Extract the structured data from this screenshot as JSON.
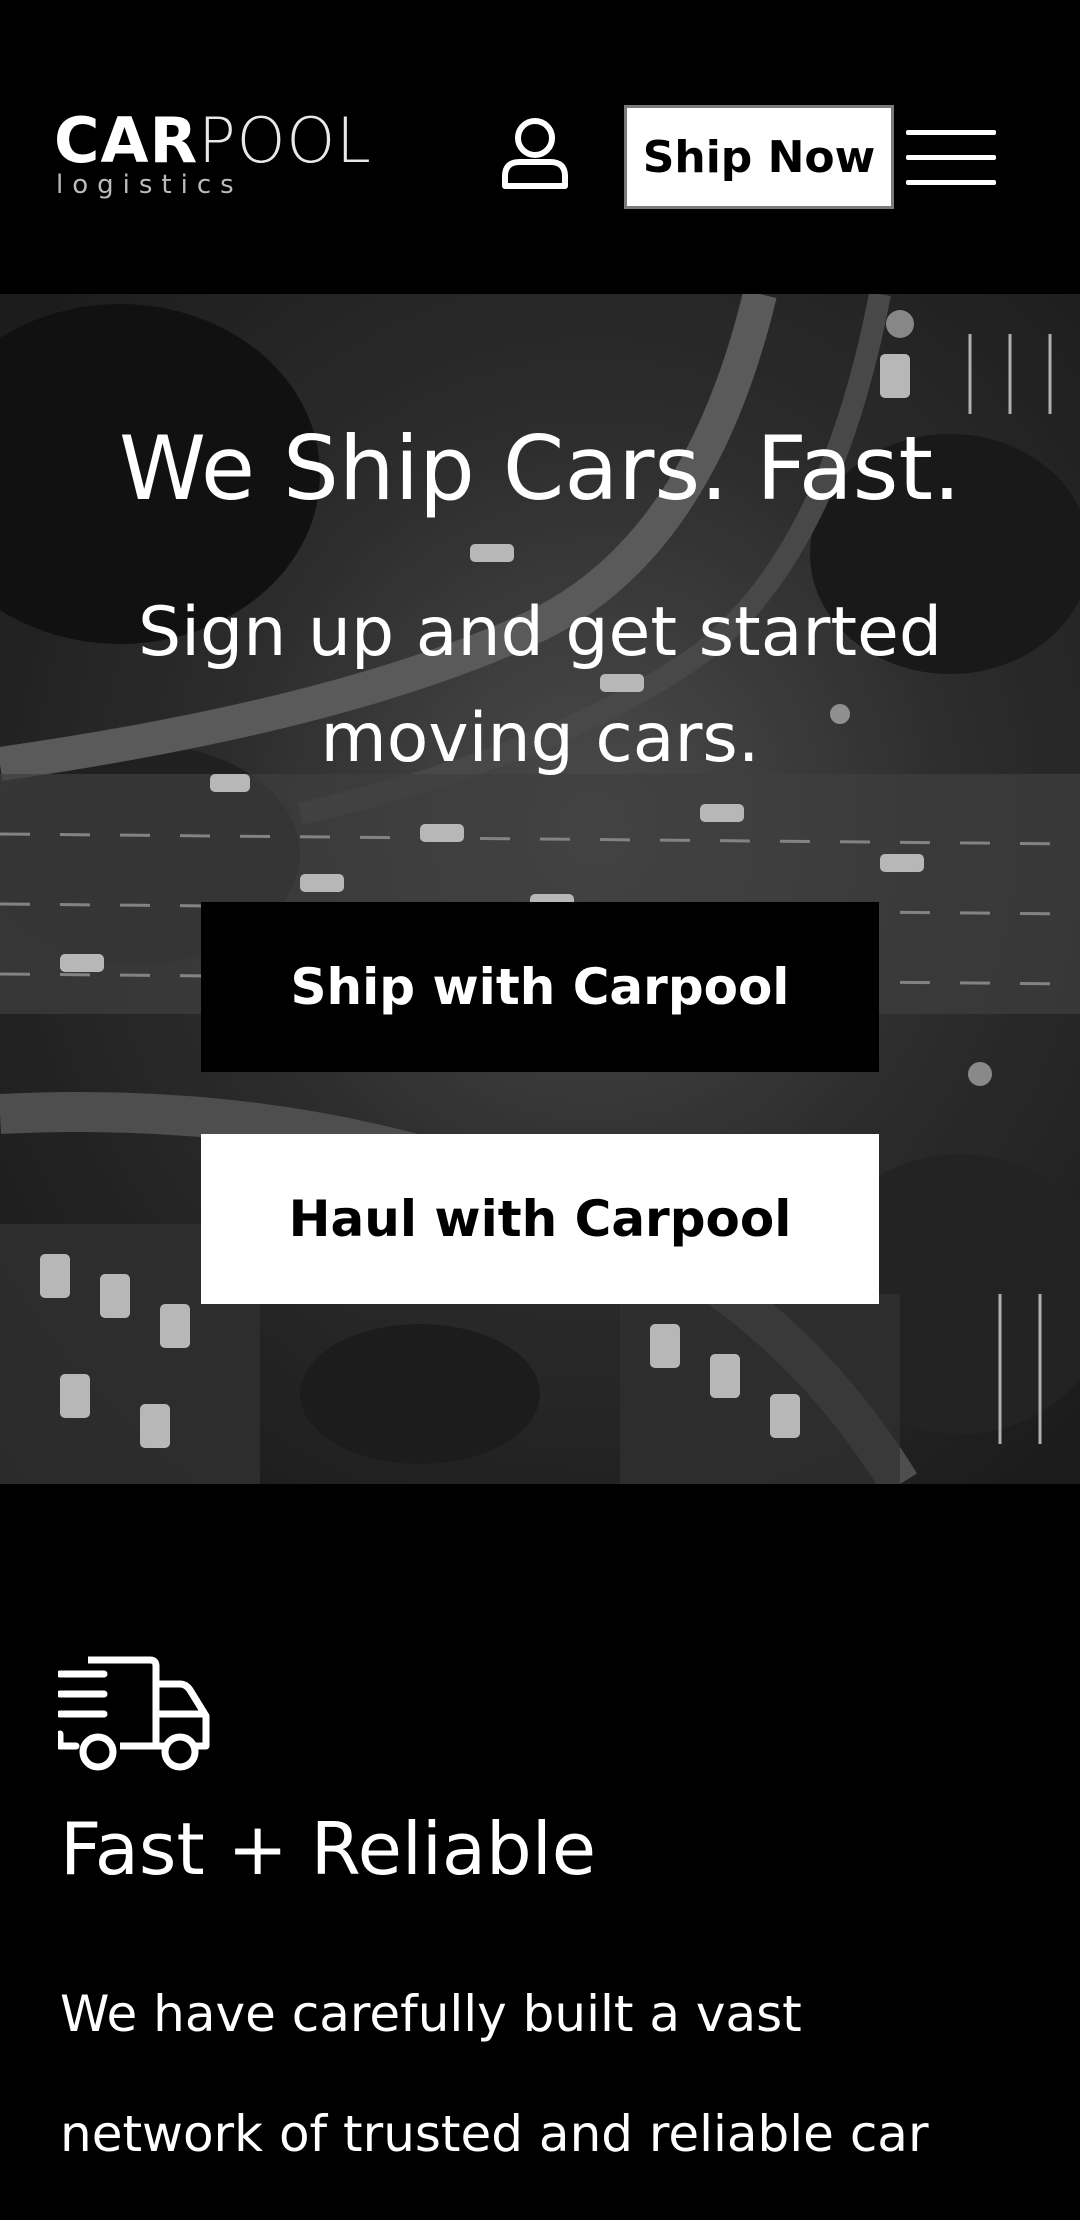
{
  "header": {
    "logo": {
      "word_part1": "CAR",
      "word_part2": "POOL",
      "subtitle": "logistics"
    },
    "ship_now_label": "Ship Now",
    "icons": {
      "account": "user-icon",
      "menu": "hamburger-menu-icon"
    }
  },
  "hero": {
    "title": "We Ship Cars. Fast.",
    "subtitle": "Sign up and get started moving cars.",
    "primary_cta": "Ship with Carpool",
    "secondary_cta": "Haul with Carpool"
  },
  "feature": {
    "icon": "delivery-truck-icon",
    "title": "Fast + Reliable",
    "body": "We have carefully built a vast network of trusted and reliable car"
  },
  "colors": {
    "background": "#000000",
    "text": "#ffffff",
    "button_dark": "#000000",
    "button_light": "#ffffff",
    "button_border": "#7a7a7a"
  }
}
